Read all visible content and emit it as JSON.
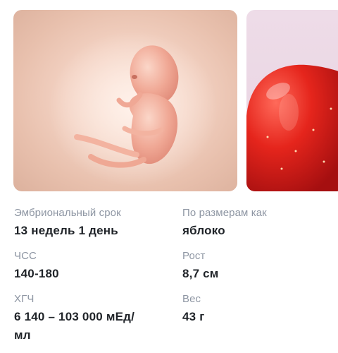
{
  "images": {
    "embryo": "embryo-illustration",
    "apple": "apple-photo"
  },
  "colors": {
    "label": "#8e96a3",
    "value": "#1f2328",
    "apple_bg": "#eedce8",
    "embryo_bg": "#f3d2c3"
  },
  "stats": {
    "embryonic_term": {
      "label": "Эмбриональный срок",
      "value": "13 недель 1 день"
    },
    "size_like": {
      "label": "По размерам как",
      "value": "яблоко"
    },
    "heart_rate": {
      "label": "ЧСС",
      "value": "140-180"
    },
    "height": {
      "label": "Рост",
      "value": "8,7 см"
    },
    "hcg": {
      "label": "ХГЧ",
      "value_line1": "6 140 – 103 000 мЕд/",
      "value_line2": "мл"
    },
    "weight": {
      "label": "Вес",
      "value": "43 г"
    }
  }
}
